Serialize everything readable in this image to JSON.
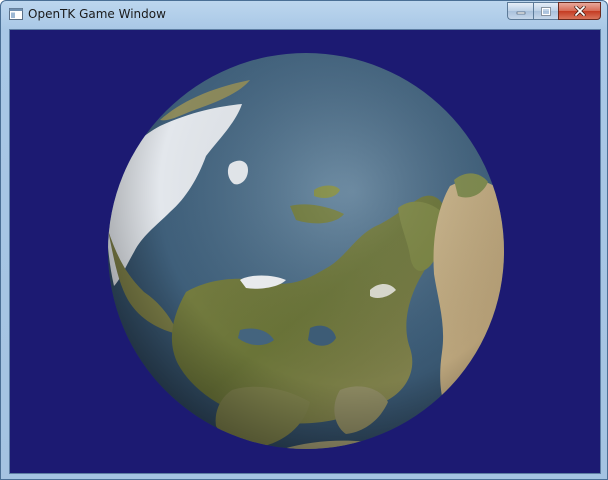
{
  "window": {
    "title": "OpenTK Game Window",
    "icon": "app-window-icon",
    "buttons": [
      "minimize-icon",
      "maximize-icon",
      "close-icon"
    ]
  },
  "scene": {
    "background_color": "#1c1a72",
    "object": "textured globe",
    "ocean_color": "#3b5a76",
    "land_color": "#6f7a3c",
    "ice_color": "#e6eaef"
  }
}
